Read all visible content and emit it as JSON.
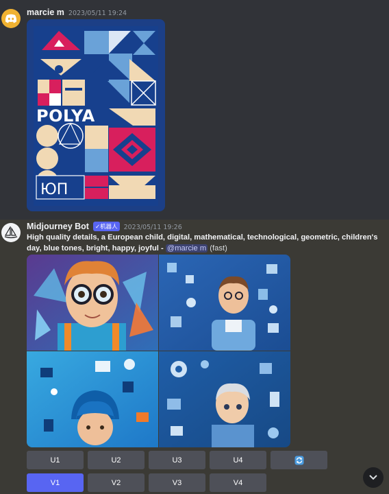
{
  "messages": [
    {
      "author": "marcie m",
      "timestamp": "2023/05/11 19:24",
      "attachment": {
        "logo_text": "POLYA",
        "glyph_text": "ЮП"
      }
    },
    {
      "author": "Midjourney Bot",
      "badge": "✓机器人",
      "timestamp": "2023/05/11 19:26",
      "prompt": "High quality details, a European child, digital, mathematical, technological, geometric, children's day, blue tones, bright, happy, joyful",
      "separator": " - ",
      "mention": "@marcie m",
      "mode": " (fast)"
    }
  ],
  "upscale_buttons": [
    "U1",
    "U2",
    "U3",
    "U4"
  ],
  "variation_buttons": [
    "V1",
    "V2",
    "V3",
    "V4"
  ],
  "reroll_icon": "refresh-icon",
  "colors": {
    "accent": "#5865f2",
    "button": "#4e5058",
    "background": "#313338",
    "bot_bg": "#3b3a35"
  }
}
